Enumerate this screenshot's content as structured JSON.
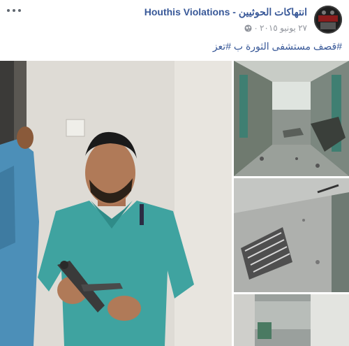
{
  "post": {
    "page_name": "Houthis Violations - انتهاكات الحوثيين",
    "date": "٢٧ يونيو ٢٠١٥ ·",
    "privacy_icon": "globe-icon",
    "more_icon": "more-options-icon",
    "caption_hashtags": [
      "#قصف مستشفى الثورة ب",
      "#تعز"
    ]
  },
  "colors": {
    "link": "#385898",
    "meta": "#90949c",
    "scrub_green": "#3fa3a0"
  }
}
